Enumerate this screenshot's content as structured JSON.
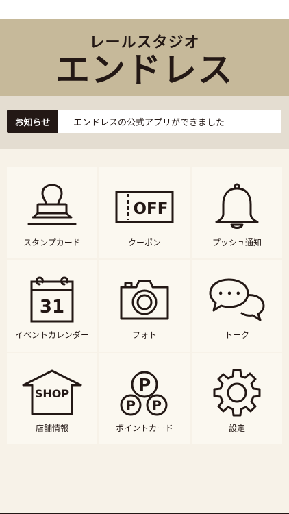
{
  "header": {
    "subtitle": "レールスタジオ",
    "title": "エンドレス"
  },
  "news": {
    "label": "お知らせ",
    "message": "エンドレスの公式アプリができました"
  },
  "menu": {
    "items": [
      {
        "label": "スタンプカード",
        "icon": "stamp-icon"
      },
      {
        "label": "クーポン",
        "icon": "coupon-icon",
        "icon_text": "OFF"
      },
      {
        "label": "プッシュ通知",
        "icon": "bell-icon"
      },
      {
        "label": "イベントカレンダー",
        "icon": "calendar-icon",
        "icon_text": "31"
      },
      {
        "label": "フォト",
        "icon": "camera-icon"
      },
      {
        "label": "トーク",
        "icon": "chat-bubbles-icon",
        "icon_text": "• • •"
      },
      {
        "label": "店舗情報",
        "icon": "shop-icon",
        "icon_text": "SHOP"
      },
      {
        "label": "ポイントカード",
        "icon": "points-icon",
        "icon_text": "P"
      },
      {
        "label": "設定",
        "icon": "gear-icon"
      }
    ]
  },
  "colors": {
    "header_bg": "#c6b99a",
    "news_band_bg": "#e4ddd1",
    "page_bg": "#f7f2e8",
    "tile_bg": "#fbf8f0",
    "ink": "#231815"
  }
}
